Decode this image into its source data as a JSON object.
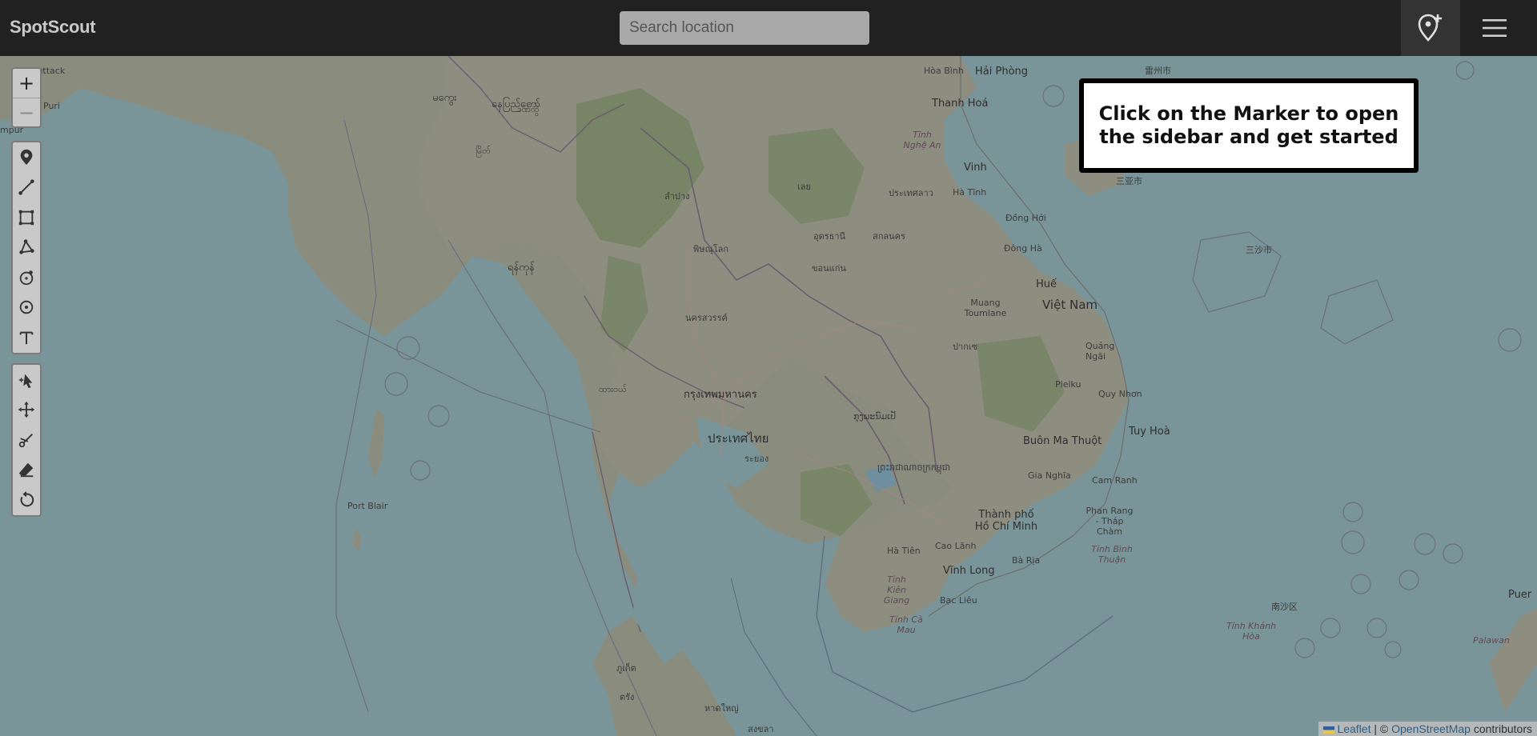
{
  "app": {
    "brand": "SpotScout"
  },
  "header": {
    "search_placeholder": "Search location",
    "add_marker_icon": "map-pin-plus-icon",
    "menu_icon": "hamburger-menu-icon"
  },
  "map": {
    "zoom_in": "+",
    "zoom_out": "−",
    "draw_tools": [
      "marker-icon",
      "polyline-icon",
      "rectangle-icon",
      "polygon-icon",
      "circle-icon",
      "circle-marker-icon",
      "text-icon"
    ],
    "edit_tools": [
      "edit-icon",
      "drag-icon",
      "cut-icon",
      "eraser-icon",
      "rotate-icon"
    ],
    "hint": "Click on the Marker to open the sidebar and get started",
    "attribution": {
      "leaflet": "Leaflet",
      "separator": " | © ",
      "osm": "OpenStreetMap",
      "suffix": " contributors"
    },
    "places": [
      {
        "name": "Puttack",
        "cls": "small"
      },
      {
        "name": "Puri",
        "cls": "small"
      },
      {
        "name": "mpur",
        "cls": "small"
      },
      {
        "name": "Hòa Bình",
        "cls": "small"
      },
      {
        "name": "Hải Phòng",
        "cls": ""
      },
      {
        "name": "Thanh Hoá",
        "cls": ""
      },
      {
        "name": "Tĩnh Nghệ An",
        "cls": "italic"
      },
      {
        "name": "Vinh",
        "cls": ""
      },
      {
        "name": "Hà Tĩnh",
        "cls": "small"
      },
      {
        "name": "Đồng Hới",
        "cls": "small"
      },
      {
        "name": "Đông Hà",
        "cls": "small"
      },
      {
        "name": "Huế",
        "cls": ""
      },
      {
        "name": "Việt Nam",
        "cls": "big"
      },
      {
        "name": "Quảng Ngãi",
        "cls": "small"
      },
      {
        "name": "Pleiku",
        "cls": "small"
      },
      {
        "name": "Quy Nhơn",
        "cls": "small"
      },
      {
        "name": "Tuy Hoà",
        "cls": ""
      },
      {
        "name": "Buôn Ma Thuột",
        "cls": ""
      },
      {
        "name": "Gia Nghĩa",
        "cls": "small"
      },
      {
        "name": "Cam Ranh",
        "cls": "small"
      },
      {
        "name": "Thành phố Hồ Chí Minh",
        "cls": ""
      },
      {
        "name": "Phan Rang - Tháp Chàm",
        "cls": "small"
      },
      {
        "name": "Tỉnh Bình Thuận",
        "cls": "italic"
      },
      {
        "name": "Cao Lãnh",
        "cls": "small"
      },
      {
        "name": "Vĩnh Long",
        "cls": ""
      },
      {
        "name": "Bà Rịa",
        "cls": "small"
      },
      {
        "name": "Hà Tiên",
        "cls": "small"
      },
      {
        "name": "Tỉnh Kiên Giang",
        "cls": "italic"
      },
      {
        "name": "Bạc Liêu",
        "cls": "small"
      },
      {
        "name": "Tỉnh Cà Mau",
        "cls": "italic"
      },
      {
        "name": "Muang Toumlane",
        "cls": "small"
      },
      {
        "name": "Port Blair",
        "cls": "small"
      },
      {
        "name": "Tỉnh Khánh Hòa",
        "cls": "italic"
      },
      {
        "name": "Palawan",
        "cls": "italic"
      },
      {
        "name": "Puer",
        "cls": ""
      },
      {
        "name": "三沙市",
        "cls": "small"
      },
      {
        "name": "南沙区",
        "cls": "small"
      },
      {
        "name": "三亚市",
        "cls": "small"
      },
      {
        "name": "雷州市",
        "cls": "small"
      },
      {
        "name": "กรุงเทพมหานคร",
        "cls": ""
      },
      {
        "name": "ประเทศไทย",
        "cls": "big"
      },
      {
        "name": "ระยอง",
        "cls": "small"
      },
      {
        "name": "นครสวรรค์",
        "cls": "small"
      },
      {
        "name": "พิษณุโลก",
        "cls": "small"
      },
      {
        "name": "ลำปาง",
        "cls": "small"
      },
      {
        "name": "เลย",
        "cls": "small"
      },
      {
        "name": "อุดรธานี",
        "cls": "small"
      },
      {
        "name": "ขอนแก่น",
        "cls": "small"
      },
      {
        "name": "ประเทศลาว",
        "cls": "small"
      },
      {
        "name": "สกลนคร",
        "cls": "small"
      },
      {
        "name": "ปากเซ",
        "cls": "small"
      },
      {
        "name": "ກຸງພະນົມເປັ",
        "cls": "small"
      },
      {
        "name": "ព្រះរាជាណាចក្រកម្ពុជា",
        "cls": "small"
      },
      {
        "name": "ဒဏ်ထွဲ",
        "cls": "small"
      },
      {
        "name": "နေပြည်တော်",
        "cls": ""
      },
      {
        "name": "မကွေး",
        "cls": ""
      },
      {
        "name": "မြိတ်",
        "cls": "small"
      },
      {
        "name": "ရန်ကုန်",
        "cls": ""
      },
      {
        "name": "ထားဝယ်",
        "cls": "small"
      },
      {
        "name": "ภูเก็ต",
        "cls": "small"
      },
      {
        "name": "ตรัง",
        "cls": "small"
      },
      {
        "name": "หาดใหญ่",
        "cls": "small"
      },
      {
        "name": "สงขลา",
        "cls": "small"
      }
    ]
  }
}
